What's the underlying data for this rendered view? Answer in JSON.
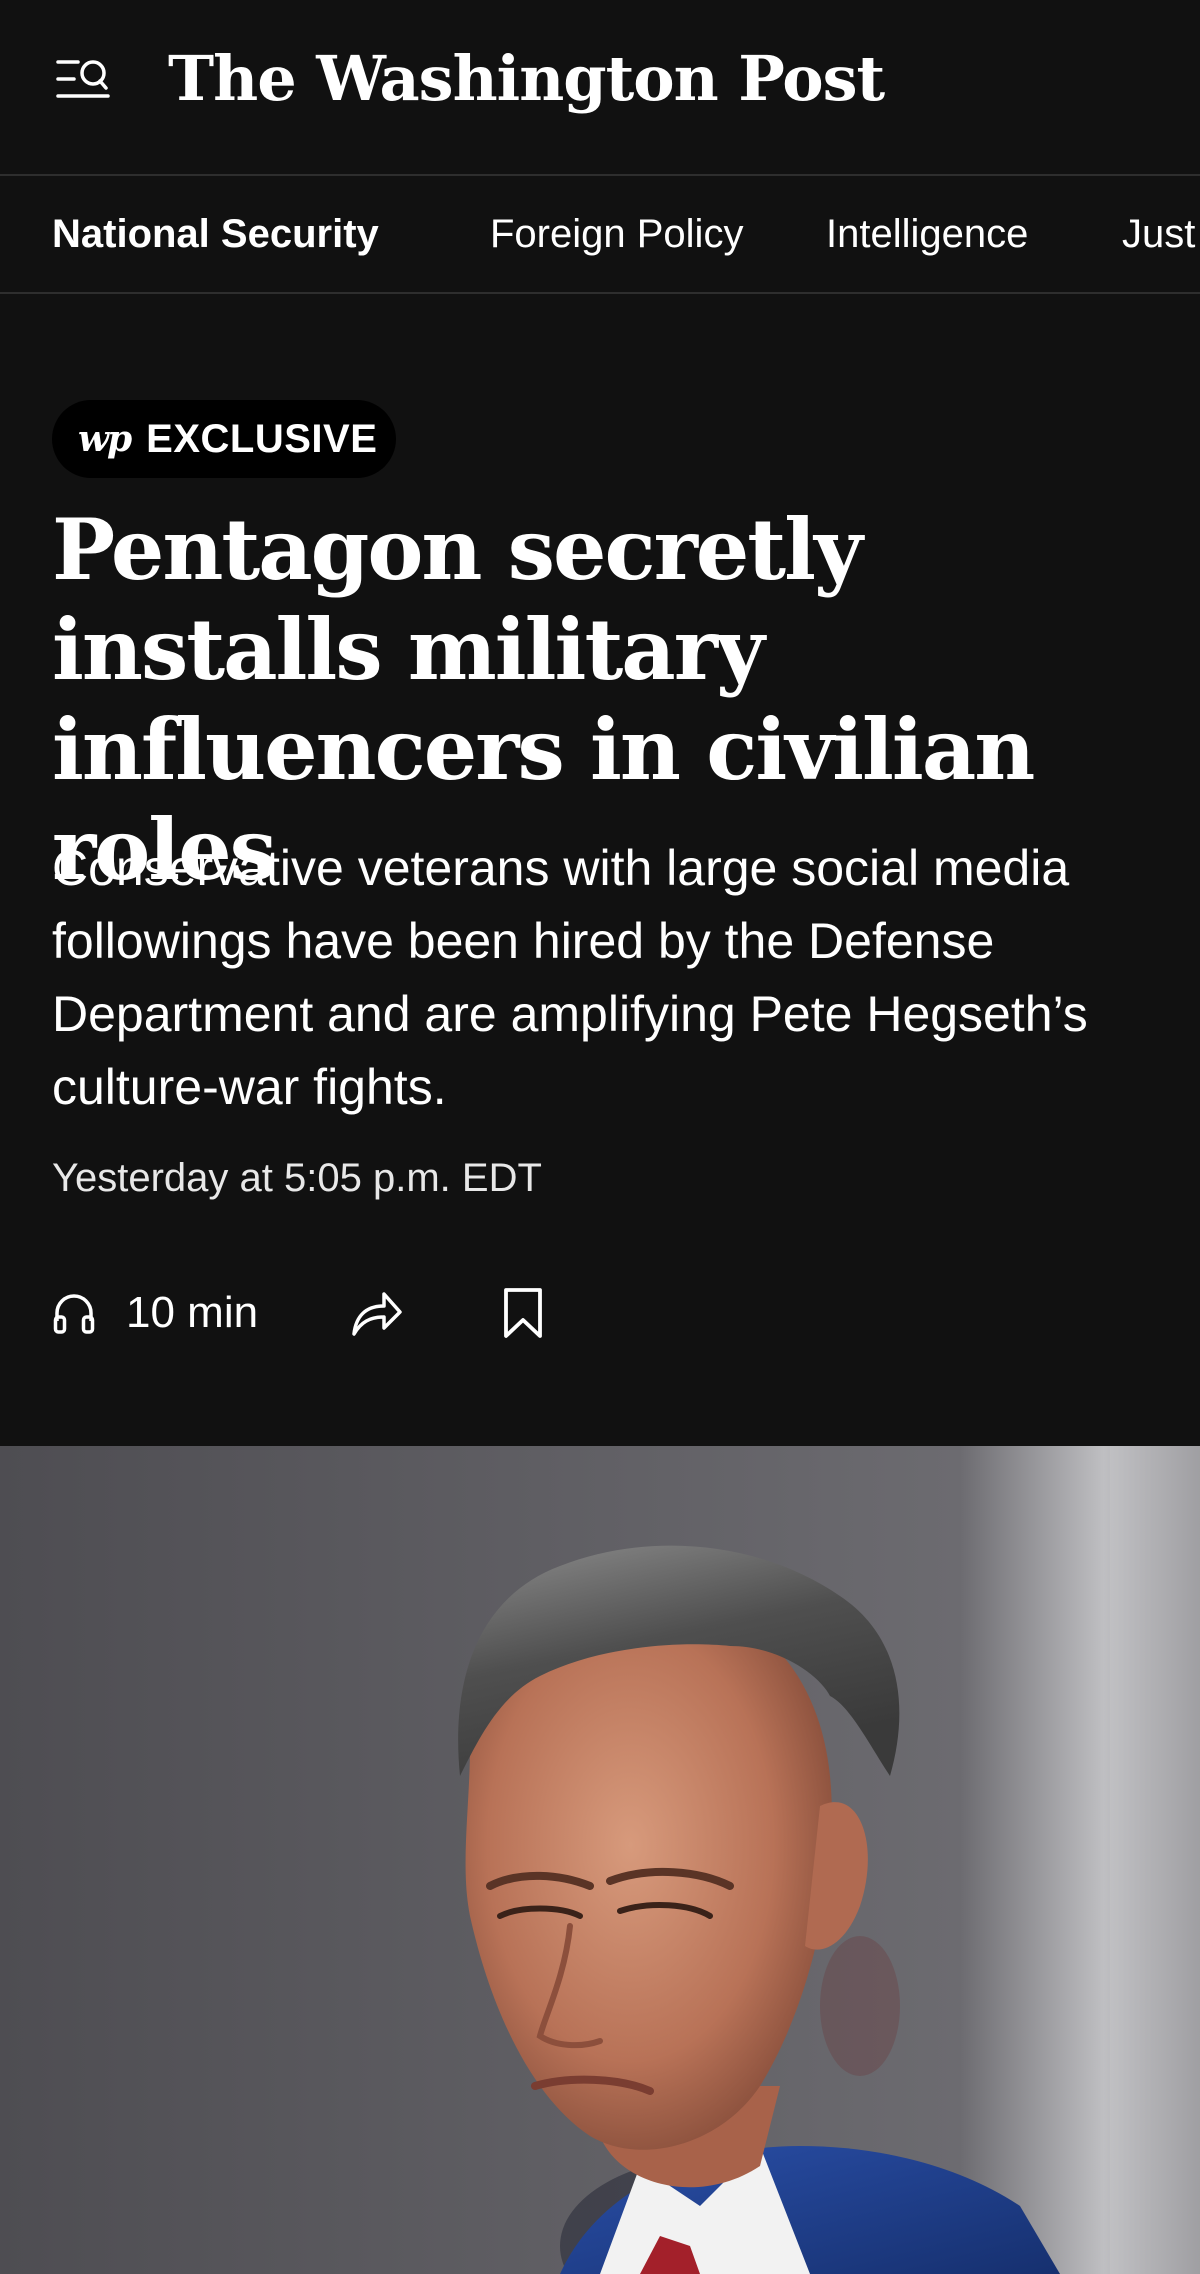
{
  "header": {
    "brand": "The Washington Post"
  },
  "section_nav": {
    "items": [
      {
        "label": "National Security",
        "active": true
      },
      {
        "label": "Foreign Policy",
        "active": false
      },
      {
        "label": "Intelligence",
        "active": false
      },
      {
        "label": "Just",
        "active": false
      }
    ]
  },
  "article": {
    "badge": {
      "logo": "wp",
      "label": "EXCLUSIVE"
    },
    "headline": "Pentagon secretly installs military influencers in civilian roles",
    "dek": "Conservative veterans with large social media followings have been hired by the Defense Department and are amplifying Pete Hegseth’s culture-war fights.",
    "timestamp": "Yesterday at 5:05 p.m. EDT",
    "actions": {
      "listen_label": "10 min"
    }
  },
  "icons": {
    "menu": "menu-search-icon",
    "listen": "headphones-icon",
    "share": "share-icon",
    "bookmark": "bookmark-icon"
  },
  "colors": {
    "background": "#111111",
    "text": "#ffffff",
    "divider": "#2e2e2e",
    "badge_background": "#000000",
    "suit_blue": "#1f3d8a",
    "tie_red": "#a3202a"
  }
}
